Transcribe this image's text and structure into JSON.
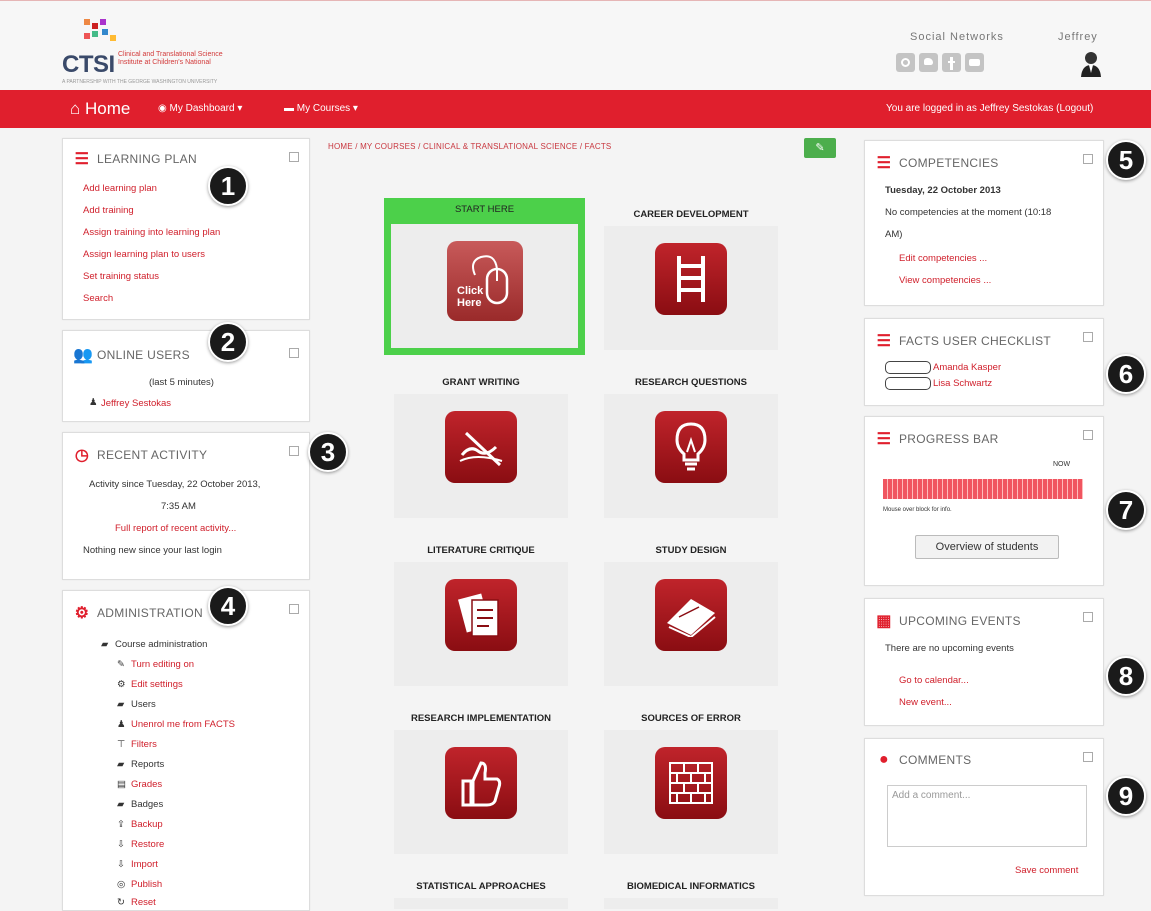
{
  "header": {
    "logo_text": "CTSI",
    "logo_sub": "Clinical and Translational Science Institute at Children's National",
    "logo_tiny": "A PARTNERSHIP WITH THE GEORGE WASHINGTON UNIVERSITY",
    "social_label": "Social Networks",
    "user_name": "Jeffrey"
  },
  "nav": {
    "home": "Home",
    "dashboard": "My Dashboard",
    "courses": "My Courses",
    "logged_in": "You are logged in as Jeffrey Sestokas (Logout)"
  },
  "learning_plan": {
    "title": "Learning Plan",
    "links": [
      "Add learning plan",
      "Add training",
      "Assign training into learning plan",
      "Assign learning plan to users",
      "Set training status",
      "Search"
    ]
  },
  "online_users": {
    "title": "Online Users",
    "subtitle": "(last 5 minutes)",
    "user": "Jeffrey Sestokas"
  },
  "recent_activity": {
    "title": "Recent Activity",
    "since_line1": "Activity since Tuesday, 22 October 2013,",
    "since_line2": "7:35 AM",
    "report_link": "Full report of recent activity...",
    "nothing": "Nothing new since your last login"
  },
  "administration": {
    "title": "Administration",
    "section": "Course administration",
    "items": [
      {
        "label": "Turn editing on",
        "link": true
      },
      {
        "label": "Edit settings",
        "link": true
      },
      {
        "label": "Users",
        "link": false
      },
      {
        "label": "Unenrol me from FACTS",
        "link": true
      },
      {
        "label": "Filters",
        "link": true
      },
      {
        "label": "Reports",
        "link": false
      },
      {
        "label": "Grades",
        "link": true
      },
      {
        "label": "Badges",
        "link": false
      },
      {
        "label": "Backup",
        "link": true
      },
      {
        "label": "Restore",
        "link": true
      },
      {
        "label": "Import",
        "link": true
      },
      {
        "label": "Publish",
        "link": true
      },
      {
        "label": "Reset",
        "link": true
      }
    ]
  },
  "breadcrumb": "HOME / MY COURSES / CLINICAL & TRANSLATIONAL SCIENCE / FACTS",
  "tiles": {
    "start_here": "START HERE",
    "click_here_1": "Click",
    "click_here_2": "Here",
    "career": "CAREER DEVELOPMENT",
    "grant": "GRANT WRITING",
    "research_q": "RESEARCH QUESTIONS",
    "literature": "LITERATURE CRITIQUE",
    "study": "STUDY DESIGN",
    "implementation": "RESEARCH IMPLEMENTATION",
    "error": "SOURCES OF ERROR",
    "statistical": "STATISTICAL APPROACHES",
    "biomedical": "BIOMEDICAL INFORMATICS"
  },
  "competencies": {
    "title": "Competencies",
    "date": "Tuesday, 22 October 2013",
    "line1": "No competencies at the moment (10:18",
    "line2": "AM)",
    "edit": "Edit competencies ...",
    "view": "View competencies ..."
  },
  "checklist": {
    "title": "FACTS User Checklist",
    "users": [
      "Amanda Kasper",
      "Lisa Schwartz"
    ]
  },
  "progress": {
    "title": "Progress Bar",
    "now": "NOW",
    "hint": "Mouse over block for info.",
    "button": "Overview of students"
  },
  "events": {
    "title": "Upcoming Events",
    "none": "There are no upcoming events",
    "calendar": "Go to calendar...",
    "new": "New event..."
  },
  "comments": {
    "title": "Comments",
    "placeholder": "Add a comment...",
    "save": "Save comment"
  },
  "badges": [
    "1",
    "2",
    "3",
    "4",
    "5",
    "6",
    "7",
    "8",
    "9"
  ]
}
